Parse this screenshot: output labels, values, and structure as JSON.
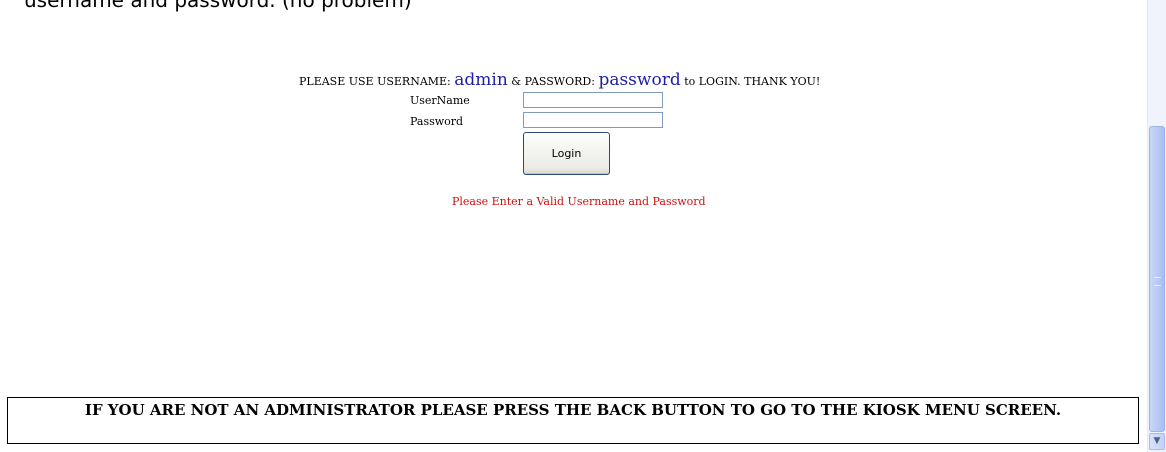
{
  "caption": "username and password. (no problem)",
  "instruction": {
    "prefix": "PLEASE USE USERNAME:",
    "username": "admin",
    "middle": "& PASSWORD:",
    "password": "password",
    "suffix": "to LOGIN. THANK YOU!"
  },
  "form": {
    "username_label": "UserName",
    "password_label": "Password",
    "username_value": "",
    "password_value": "",
    "login_label": "Login"
  },
  "error_message": "Please Enter a Valid Username and Password",
  "footer_notice": "IF YOU ARE NOT AN ADMINISTRATOR PLEASE PRESS THE BACK BUTTON TO GO TO THE KIOSK MENU SCREEN.",
  "scrollbar": {
    "down_arrow": "chevron-down-icon"
  }
}
